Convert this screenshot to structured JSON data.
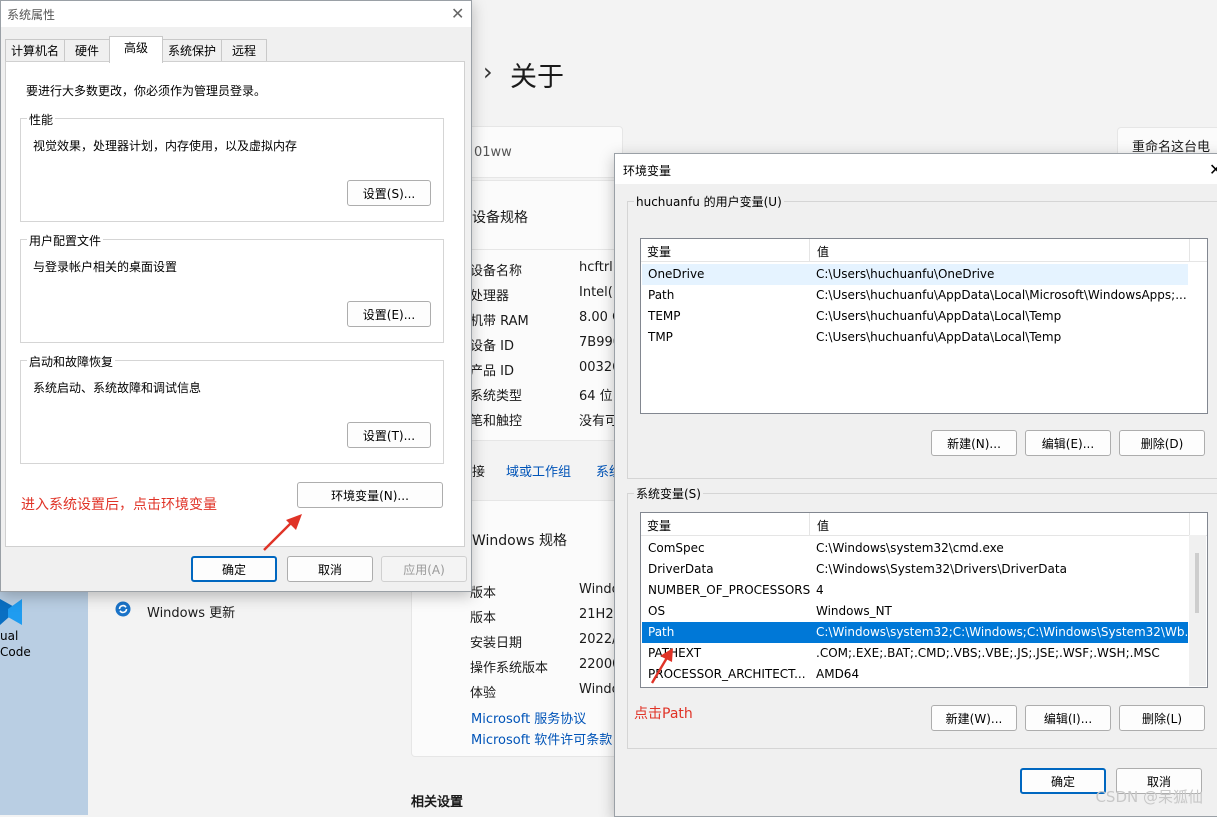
{
  "settings": {
    "breadcrumb_chevron": "›",
    "page_title": "关于",
    "rename_button": "重命名这台电",
    "device_name_partial": "01ww",
    "device_specs_heading": "设备规格",
    "specs": [
      {
        "label": "设备名称",
        "value": "hcftrl"
      },
      {
        "label": "处理器",
        "value": "Intel(R"
      },
      {
        "label": "机带 RAM",
        "value": "8.00 G"
      },
      {
        "label": "设备 ID",
        "value": "7B990"
      },
      {
        "label": "产品 ID",
        "value": "00326"
      },
      {
        "label": "系统类型",
        "value": "64 位"
      },
      {
        "label": "笔和触控",
        "value": "没有可"
      }
    ],
    "links_row": {
      "prefix": "接",
      "domain": "域或工作组",
      "system": "系统"
    },
    "windows_specs_heading": "Windows 规格",
    "win_specs": [
      {
        "label": "版本",
        "value": "Windo"
      },
      {
        "label": "版本",
        "value": "21H2"
      },
      {
        "label": "安装日期",
        "value": "2022/"
      },
      {
        "label": "操作系统版本",
        "value": "22000"
      },
      {
        "label": "体验",
        "value": "Windo"
      }
    ],
    "service_link": "Microsoft 服务协议",
    "license_link": "Microsoft 软件许可条款",
    "windows_update": "Windows 更新",
    "related_settings": "相关设置"
  },
  "desktop": {
    "icon_label": "ual\nCode"
  },
  "sysprops": {
    "title": "系统属性",
    "tabs": [
      "计算机名",
      "硬件",
      "高级",
      "系统保护",
      "远程"
    ],
    "active_tab": 2,
    "admin_note": "要进行大多数更改，你必须作为管理员登录。",
    "groups": [
      {
        "title": "性能",
        "desc": "视觉效果，处理器计划，内存使用，以及虚拟内存",
        "button": "设置(S)..."
      },
      {
        "title": "用户配置文件",
        "desc": "与登录帐户相关的桌面设置",
        "button": "设置(E)..."
      },
      {
        "title": "启动和故障恢复",
        "desc": "系统启动、系统故障和调试信息",
        "button": "设置(T)..."
      }
    ],
    "env_button": "环境变量(N)...",
    "ok": "确定",
    "cancel": "取消",
    "apply": "应用(A)"
  },
  "annotation_env": "进入系统设置后，点击环境变量",
  "annotation_path": "点击Path",
  "envvars": {
    "title": "环境变量",
    "user_section": "huchuanfu 的用户变量(U)",
    "col_var": "变量",
    "col_val": "值",
    "user_vars": [
      {
        "name": "OneDrive",
        "value": "C:\\Users\\huchuanfu\\OneDrive"
      },
      {
        "name": "Path",
        "value": "C:\\Users\\huchuanfu\\AppData\\Local\\Microsoft\\WindowsApps;..."
      },
      {
        "name": "TEMP",
        "value": "C:\\Users\\huchuanfu\\AppData\\Local\\Temp"
      },
      {
        "name": "TMP",
        "value": "C:\\Users\\huchuanfu\\AppData\\Local\\Temp"
      }
    ],
    "user_buttons": {
      "new": "新建(N)...",
      "edit": "编辑(E)...",
      "delete": "删除(D)"
    },
    "system_section": "系统变量(S)",
    "system_vars": [
      {
        "name": "ComSpec",
        "value": "C:\\Windows\\system32\\cmd.exe"
      },
      {
        "name": "DriverData",
        "value": "C:\\Windows\\System32\\Drivers\\DriverData"
      },
      {
        "name": "NUMBER_OF_PROCESSORS",
        "value": "4"
      },
      {
        "name": "OS",
        "value": "Windows_NT"
      },
      {
        "name": "Path",
        "value": "C:\\Windows\\system32;C:\\Windows;C:\\Windows\\System32\\Wb..."
      },
      {
        "name": "PATHEXT",
        "value": ".COM;.EXE;.BAT;.CMD;.VBS;.VBE;.JS;.JSE;.WSF;.WSH;.MSC"
      },
      {
        "name": "PROCESSOR_ARCHITECT...",
        "value": "AMD64"
      }
    ],
    "selected_system_row": 4,
    "system_buttons": {
      "new": "新建(W)...",
      "edit": "编辑(I)...",
      "delete": "删除(L)"
    },
    "ok": "确定",
    "cancel": "取消"
  },
  "watermark": "CSDN @呆狐仙",
  "colors": {
    "annotation": "#e03327",
    "selection": "#0078d7",
    "link": "#0054b8"
  }
}
